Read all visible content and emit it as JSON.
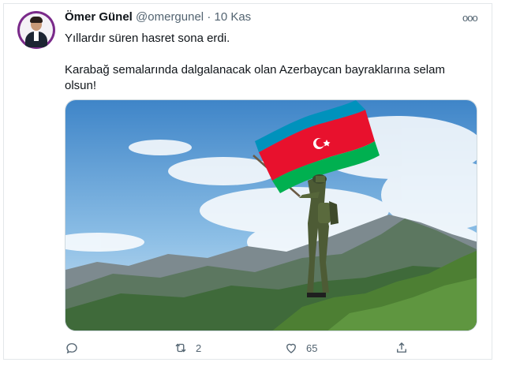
{
  "tweet": {
    "author_name": "Ömer Günel",
    "handle": "@omergunel",
    "separator": "·",
    "date": "10 Kas",
    "more_label": "ooo",
    "text_line1": "Yıllardır süren hasret sona erdi.",
    "text_line2": "Karabağ semalarında dalgalanacak olan Azerbaycan bayraklarına selam olsun!",
    "emoji": "azerbaijan-flag-emoji"
  },
  "actions": {
    "reply_count": "",
    "retweet_count": "2",
    "like_count": "65"
  },
  "icons": [
    "reply-icon",
    "retweet-icon",
    "like-icon",
    "share-icon"
  ],
  "colors": {
    "flag_blue": "#0092bc",
    "flag_red": "#e8112d",
    "flag_green": "#00b050",
    "avatar_ring": "#7a2a8a",
    "secondary_text": "#536471"
  }
}
